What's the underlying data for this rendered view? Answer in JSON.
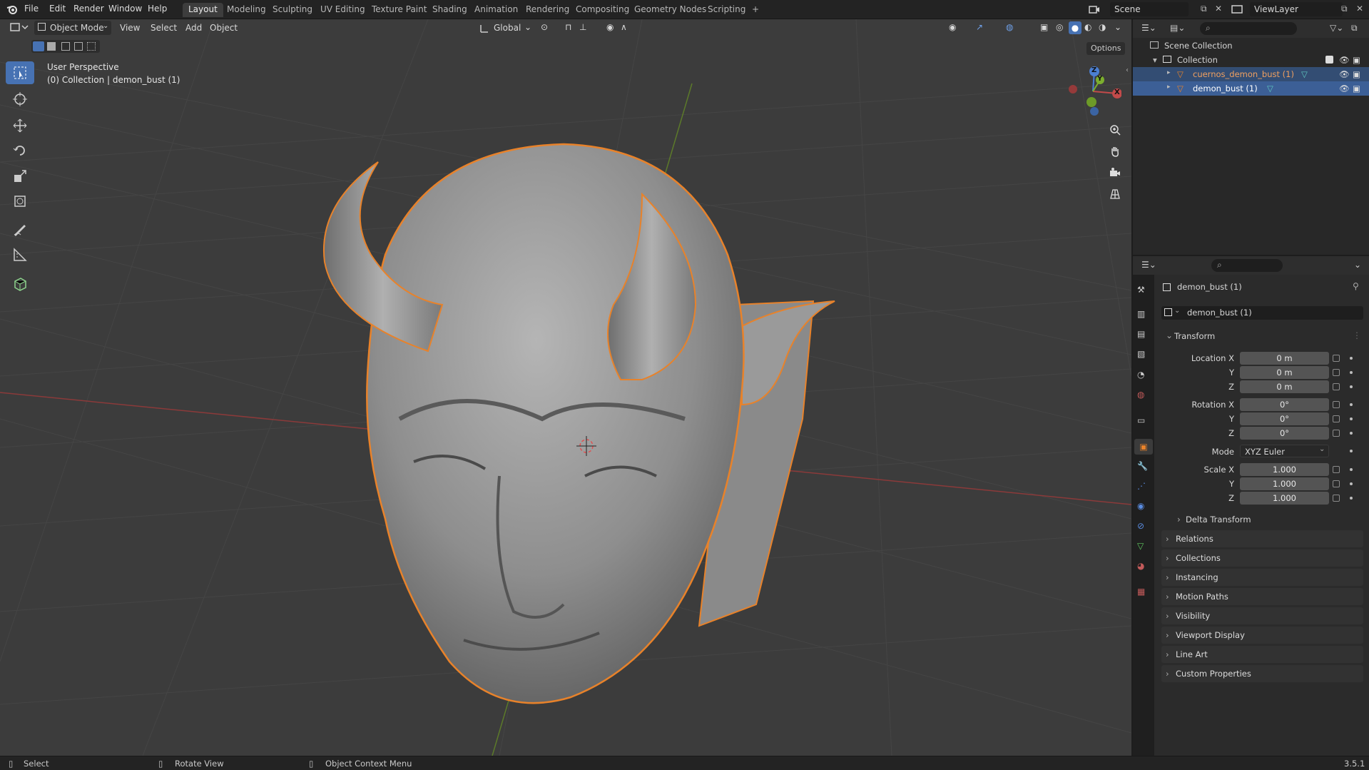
{
  "app": {
    "version": "3.5.1"
  },
  "menu": [
    "File",
    "Edit",
    "Render",
    "Window",
    "Help"
  ],
  "workspaces": [
    "Layout",
    "Modeling",
    "Sculpting",
    "UV Editing",
    "Texture Paint",
    "Shading",
    "Animation",
    "Rendering",
    "Compositing",
    "Geometry Nodes",
    "Scripting",
    "+"
  ],
  "scene": {
    "label": "Scene",
    "view_layer": "ViewLayer"
  },
  "viewport_header": {
    "mode": "Object Mode",
    "menus": [
      "View",
      "Select",
      "Add",
      "Object"
    ],
    "orientation": "Global",
    "options": "Options"
  },
  "viewport": {
    "perspective": "User Perspective",
    "collection_info": "(0) Collection | demon_bust (1)",
    "gizmo": {
      "z": "Z",
      "y": "Y",
      "x": "X"
    }
  },
  "outliner": {
    "scene_collection": "Scene Collection",
    "collection": "Collection",
    "objects": [
      "cuernos_demon_bust (1)",
      "demon_bust (1)"
    ]
  },
  "properties": {
    "object_name": "demon_bust (1)",
    "data_name": "demon_bust (1)",
    "transform_title": "Transform",
    "location": {
      "label": "Location X",
      "x": "0 m",
      "y": "0 m",
      "z": "0 m"
    },
    "rotation": {
      "label": "Rotation X",
      "x": "0°",
      "y": "0°",
      "z": "0°"
    },
    "mode": {
      "label": "Mode",
      "value": "XYZ Euler"
    },
    "scale": {
      "label": "Scale X",
      "x": "1.000",
      "y": "1.000",
      "z": "1.000"
    },
    "axis_labels": {
      "y": "Y",
      "z": "Z"
    },
    "delta_transform": "Delta Transform",
    "sections": [
      "Relations",
      "Collections",
      "Instancing",
      "Motion Paths",
      "Visibility",
      "Viewport Display",
      "Line Art",
      "Custom Properties"
    ]
  },
  "statusbar": {
    "select": "Select",
    "rotate": "Rotate View",
    "context": "Object Context Menu",
    "version": "3.5.1"
  },
  "colors": {
    "selected_outline": "#e8822a",
    "active_tab": "#4772b3",
    "x_axis": "#c24a4a",
    "y_axis": "#7cae2e"
  }
}
